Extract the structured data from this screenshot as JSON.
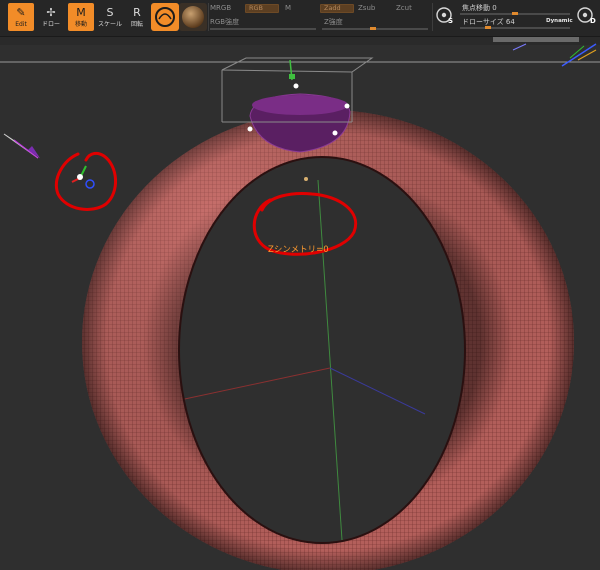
{
  "toolbar": {
    "tools": [
      {
        "name": "edit",
        "label": "Edit",
        "glyph": "✎",
        "active": true
      },
      {
        "name": "draw",
        "label": "ドロー",
        "glyph": "✢",
        "active": false
      },
      {
        "name": "move",
        "label": "移動",
        "glyph": "M",
        "active": true
      },
      {
        "name": "scale",
        "label": "スケール",
        "glyph": "S",
        "active": false
      },
      {
        "name": "rotate",
        "label": "回転",
        "glyph": "R",
        "active": false
      }
    ],
    "mrgb_label": "MRGB",
    "rgb_label": "RGB",
    "m_label": "M",
    "rgb_intensity_label": "RGB強度",
    "zadd_label": "Zadd",
    "zsub_label": "Zsub",
    "zcut_label": "Zcut",
    "z_intensity_label": "Z強度",
    "focal_shift_label": "焦点移動 0",
    "draw_size_label": "ドローサイズ 64",
    "dynamic_label": "Dynamic",
    "s_button_letter": "S",
    "d_button_letter": "D"
  },
  "viewport": {
    "symmetry_text": "Zシンメトリ=0"
  },
  "colors": {
    "accent_orange": "#f28c28",
    "torus_base": "#b65f5c",
    "annotation_red": "#e00000",
    "background": "#2f2f2f"
  }
}
